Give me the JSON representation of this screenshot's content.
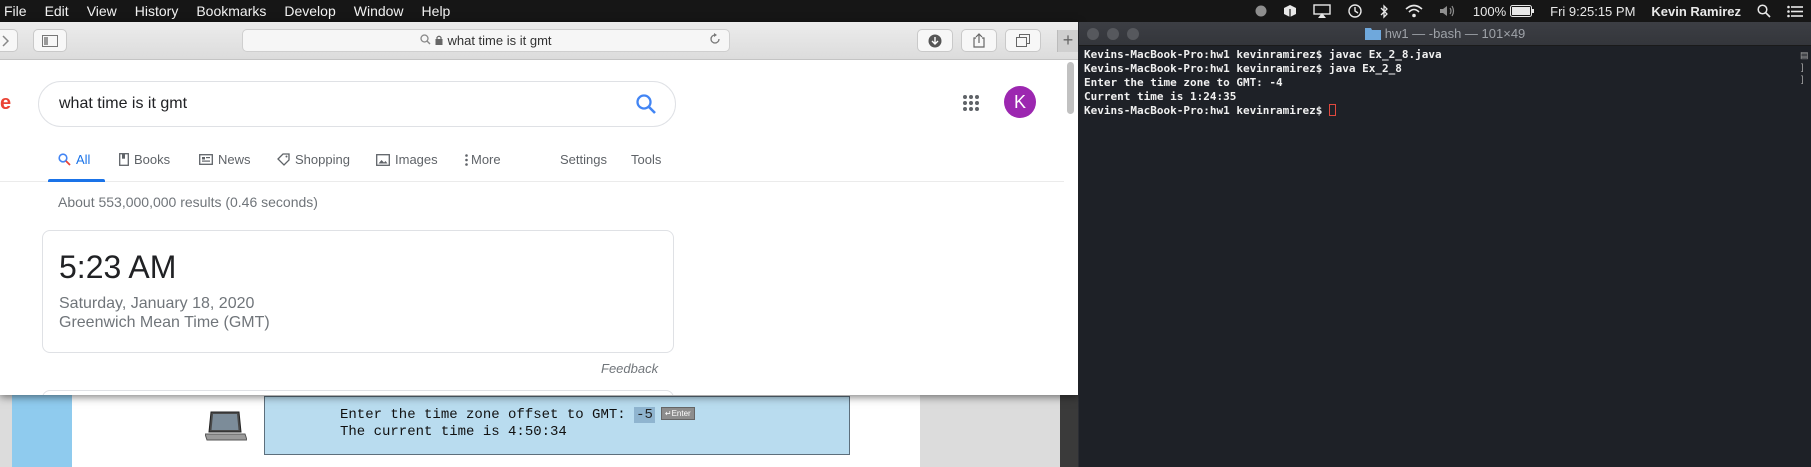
{
  "menubar": {
    "items": [
      "File",
      "Edit",
      "View",
      "History",
      "Bookmarks",
      "Develop",
      "Window",
      "Help"
    ],
    "battery": "100%",
    "clock": "Fri 9:25:15 PM",
    "user": "Kevin Ramirez",
    "icons": [
      "record-icon",
      "dropbox-icon",
      "airplay-icon",
      "time-machine-icon",
      "bluetooth-icon",
      "wifi-icon",
      "volume-icon",
      "battery-icon",
      "spotlight-icon",
      "notification-center-icon"
    ]
  },
  "safari": {
    "address": "what time is it gmt",
    "new_tab": "+"
  },
  "google": {
    "logo_fragment": "e",
    "query": "what time is it gmt",
    "avatar_letter": "K",
    "tabs": [
      {
        "label": "All",
        "icon": "search-icon",
        "active": true
      },
      {
        "label": "Books",
        "icon": "book-icon"
      },
      {
        "label": "News",
        "icon": "news-icon"
      },
      {
        "label": "Shopping",
        "icon": "tag-icon"
      },
      {
        "label": "Images",
        "icon": "image-icon"
      },
      {
        "label": "More",
        "icon": "more-vert-icon"
      },
      {
        "label": "Settings"
      },
      {
        "label": "Tools"
      }
    ],
    "result_stats": "About 553,000,000 results (0.46 seconds)",
    "time_card": {
      "time": "5:23 AM",
      "date": "Saturday, January 18, 2020",
      "timezone": "Greenwich Mean Time (GMT)"
    },
    "feedback": "Feedback"
  },
  "textbook_console": {
    "line1_prefix": "Enter the time zone offset to GMT: ",
    "line1_input": "-5",
    "enter_key": "↵Enter",
    "line2": "The current time is 4:50:34"
  },
  "terminal": {
    "title": "hw1 — -bash — 101×49",
    "lines": [
      "Kevins-MacBook-Pro:hw1 kevinramirez$ javac Ex_2_8.java",
      "Kevins-MacBook-Pro:hw1 kevinramirez$ java Ex_2_8",
      "Enter the time zone to GMT: -4",
      "Current time is 1:24:35",
      "Kevins-MacBook-Pro:hw1 kevinramirez$ "
    ]
  },
  "colors": {
    "google_blue": "#1a73e8",
    "avatar_purple": "#9c27b0",
    "terminal_bg": "#1e2127",
    "cursor_red": "#e0483e"
  }
}
